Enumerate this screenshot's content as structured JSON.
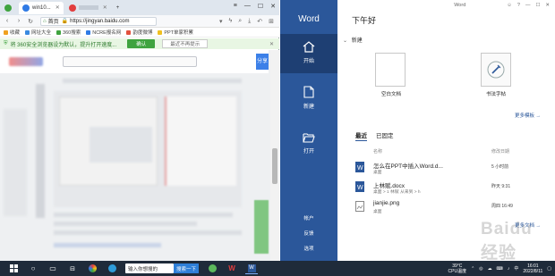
{
  "browser": {
    "tabs": [
      {
        "label": "win10...",
        "color": "#2f7ae5"
      },
      {
        "label": "",
        "color": "#e23d3d"
      }
    ],
    "url": "https://jingyan.baidu.com",
    "home_label": "首页",
    "bookmarks": [
      "收藏",
      "网址大全",
      "360搜索",
      "NCRE报名网",
      "韵度微博",
      "PPT单家积累"
    ],
    "notice": {
      "text": "将 360安全浏览器设为默认，提升打开速度...",
      "ok_label": "确认",
      "dismiss_label": "最近不再提示"
    },
    "baidu_btn": "分享"
  },
  "word": {
    "app_title": "Word",
    "greeting": "下午好",
    "titlebar": {
      "title": "Word",
      "help": "?"
    },
    "nav": {
      "home": "开始",
      "new": "新建",
      "open": "打开"
    },
    "footer": {
      "account": "帐户",
      "feedback": "反馈",
      "options": "选项"
    },
    "new_header": "新建",
    "templates": [
      {
        "label": "空白文档"
      },
      {
        "label": "书法字帖"
      }
    ],
    "more_templates": "更多模板 →",
    "tabs": {
      "recent": "最近",
      "pinned": "已固定"
    },
    "columns": {
      "name": "名称",
      "date": "修改日期"
    },
    "docs": [
      {
        "name": "怎么在PPT中插入Word.d...",
        "path": "桌面",
        "date": "5 小时前",
        "type": "word"
      },
      {
        "name": "上林赋.docx",
        "path": "桌面 > 1 林赋 从来到 > h",
        "date": "昨天 9:31",
        "type": "word"
      },
      {
        "name": "jianjie.png",
        "path": "桌面",
        "date": "周四 16:49",
        "type": "image"
      }
    ],
    "more_docs": "更多文档 →",
    "watermark": "Baidu 经验"
  },
  "taskbar": {
    "search_placeholder": "输入你想搜的",
    "search_button": "搜索一下",
    "temp": "39°C",
    "cpu": "CPU温度",
    "time": "16:01",
    "date": "2022/8/11"
  }
}
